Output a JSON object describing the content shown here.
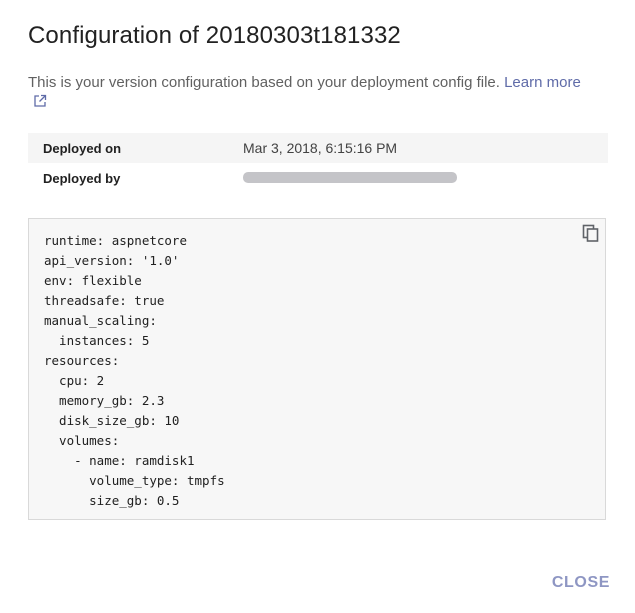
{
  "dialog": {
    "title": "Configuration of 20180303t181332",
    "description": "This is your version configuration based on your deployment config file.",
    "learn_more_label": "Learn more",
    "external_link_icon": "external-link-icon",
    "info": [
      {
        "label": "Deployed on",
        "value": "Mar 3, 2018, 6:15:16 PM"
      },
      {
        "label": "Deployed by",
        "value": ""
      }
    ],
    "config_yaml": "runtime: aspnetcore\napi_version: '1.0'\nenv: flexible\nthreadsafe: true\nmanual_scaling:\n  instances: 5\nresources:\n  cpu: 2\n  memory_gb: 2.3\n  disk_size_gb: 10\n  volumes:\n    - name: ramdisk1\n      volume_type: tmpfs\n      size_gb: 0.5",
    "copy_icon": "copy-icon",
    "close_label": "CLOSE"
  },
  "colors": {
    "link": "#5f6ba8",
    "close_button": "#8e96c3",
    "code_background": "#f7f7f7",
    "row_shade": "#f5f5f5"
  }
}
